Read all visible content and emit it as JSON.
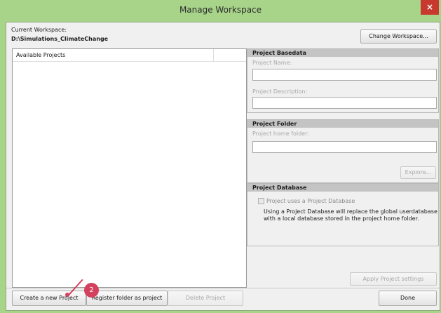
{
  "window": {
    "title": "Manage Workspace",
    "close_glyph": "×"
  },
  "workspace": {
    "label": "Current Workspace:",
    "path": "D:\\Simulations_ClimateChange",
    "change_button": "Change Workspace..."
  },
  "projects": {
    "header": "Available Projects"
  },
  "basedata": {
    "title": "Project Basedata",
    "name_label": "Project Name:",
    "name_value": "",
    "desc_label": "Project Description:",
    "desc_value": ""
  },
  "folder": {
    "title": "Project Folder",
    "home_label": "Project home folder:",
    "home_value": "",
    "explore_button": "Explore..."
  },
  "database": {
    "title": "Project Database",
    "checkbox_label": "Project uses a Project Database",
    "info": "Using a Project Database will replace the global userdatabase with a local database stored in the project home folder."
  },
  "apply_button": "Apply Project settings",
  "footer": {
    "create": "Create a new Project",
    "register": "Register folder as project",
    "delete": "Delete Project",
    "done": "Done"
  },
  "callout": {
    "number": "2",
    "color": "#d3415f"
  },
  "colors": {
    "frame": "#a8d48a",
    "close": "#c7392e",
    "panel_header": "#c4c4c4"
  }
}
